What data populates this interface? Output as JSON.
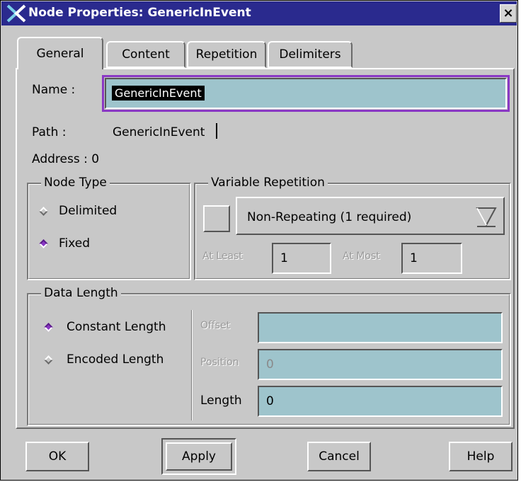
{
  "window": {
    "title": "Node Properties: GenericInEvent",
    "close_glyph": "×"
  },
  "tabs": [
    {
      "label": "General",
      "active": true
    },
    {
      "label": "Content",
      "active": false
    },
    {
      "label": "Repetition",
      "active": false
    },
    {
      "label": "Delimiters",
      "active": false
    }
  ],
  "general": {
    "name_label": "Name :",
    "name_value": "GenericInEvent",
    "path_label": "Path :",
    "path_value": "GenericInEvent",
    "address_label": "Address : 0"
  },
  "node_type": {
    "legend": "Node Type",
    "options": [
      {
        "label": "Delimited",
        "selected": false
      },
      {
        "label": "Fixed",
        "selected": true
      }
    ]
  },
  "variable_repetition": {
    "legend": "Variable Repetition",
    "selected": "Non-Repeating (1 required)",
    "at_least_label": "At Least",
    "at_least_value": "1",
    "at_most_label": "At Most",
    "at_most_value": "1"
  },
  "data_length": {
    "legend": "Data Length",
    "options": [
      {
        "label": "Constant Length",
        "selected": true
      },
      {
        "label": "Encoded Length",
        "selected": false
      }
    ],
    "offset_label": "Offset",
    "offset_value": "",
    "position_label": "Position",
    "position_value": "0",
    "length_label": "Length",
    "length_value": "0"
  },
  "buttons": {
    "ok": "OK",
    "apply": "Apply",
    "cancel": "Cancel",
    "help": "Help"
  },
  "colors": {
    "titlebar": "#2a2a8e",
    "accent": "#8a38c4",
    "field": "#9ec4cc",
    "background": "#c8c8c8"
  }
}
